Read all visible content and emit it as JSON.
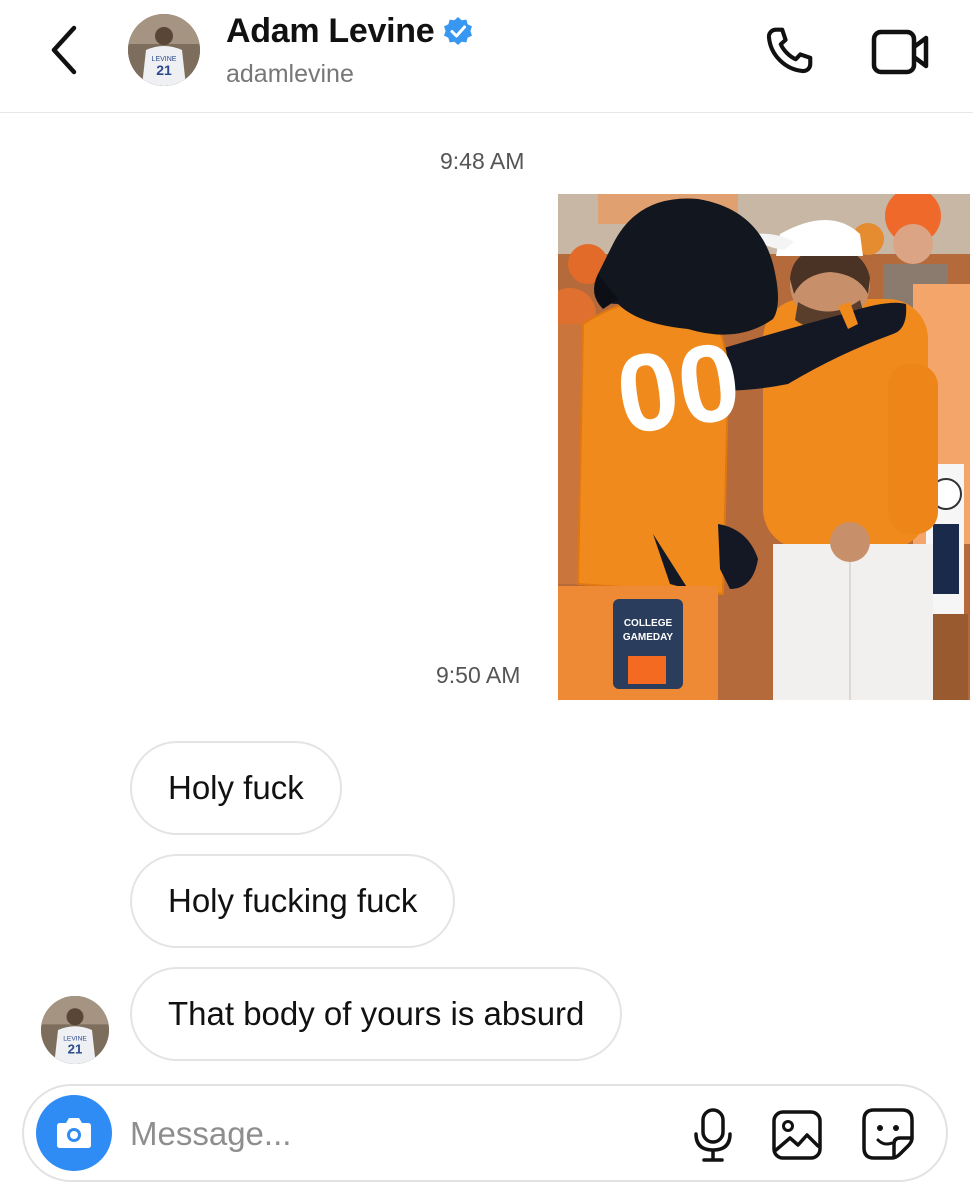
{
  "header": {
    "name": "Adam Levine",
    "handle": "adamlevine",
    "avatar_jersey": "21",
    "avatar_jersey_name": "LEVINE"
  },
  "thread": {
    "time_1": "9:48 AM",
    "time_2": "9:50 AM",
    "photo": {
      "mascot_jersey_number": "00",
      "sign_line_1": "COLLEGE",
      "sign_line_2": "GAMEDAY"
    },
    "messages": [
      {
        "text": "Holy fuck"
      },
      {
        "text": "Holy fucking fuck"
      },
      {
        "text": "That body of yours is absurd"
      }
    ]
  },
  "composer": {
    "placeholder": "Message..."
  },
  "colors": {
    "accent_blue": "#2f8cf5",
    "verified_blue": "#3897f0",
    "bubble_border": "#e4e4e4",
    "tennessee_orange": "#f08a1c"
  },
  "icons": [
    "back-arrow-icon",
    "verified-badge-icon",
    "phone-icon",
    "video-camera-icon",
    "camera-icon",
    "microphone-icon",
    "gallery-icon",
    "sticker-icon"
  ]
}
